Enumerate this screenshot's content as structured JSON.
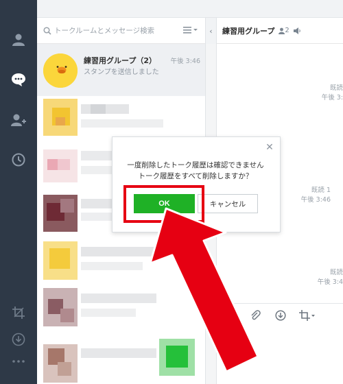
{
  "sidebar": {
    "items": [
      {
        "icon": "user-icon"
      },
      {
        "icon": "chat-icon"
      },
      {
        "icon": "add-friend-icon"
      },
      {
        "icon": "clock-icon"
      },
      {
        "icon": "crop-icon"
      },
      {
        "icon": "download-icon"
      },
      {
        "icon": "more-icon"
      }
    ]
  },
  "search": {
    "placeholder": "トークルームとメッセージ検索"
  },
  "chat_header": {
    "title": "練習用グループ",
    "member_count": "2"
  },
  "chat_list": {
    "selected": {
      "name": "練習用グループ（2）",
      "time": "午後 3:46",
      "preview": "スタンプを送信しました"
    }
  },
  "messages": [
    {
      "read": "既読",
      "time": "午後 3:"
    },
    {
      "read": "既読 1",
      "time": "午後 3:46"
    },
    {
      "read": "既読",
      "time": "午後 3:4"
    }
  ],
  "dialog": {
    "line1": "一度削除したトーク履歴は確認できません",
    "line2": "トーク履歴をすべて削除しますか？",
    "ok_label": "OK",
    "cancel_label": "キャンセル"
  },
  "colors": {
    "sidebar": "#2e3947",
    "ok_button": "#1fb126",
    "highlight": "#e60012"
  }
}
